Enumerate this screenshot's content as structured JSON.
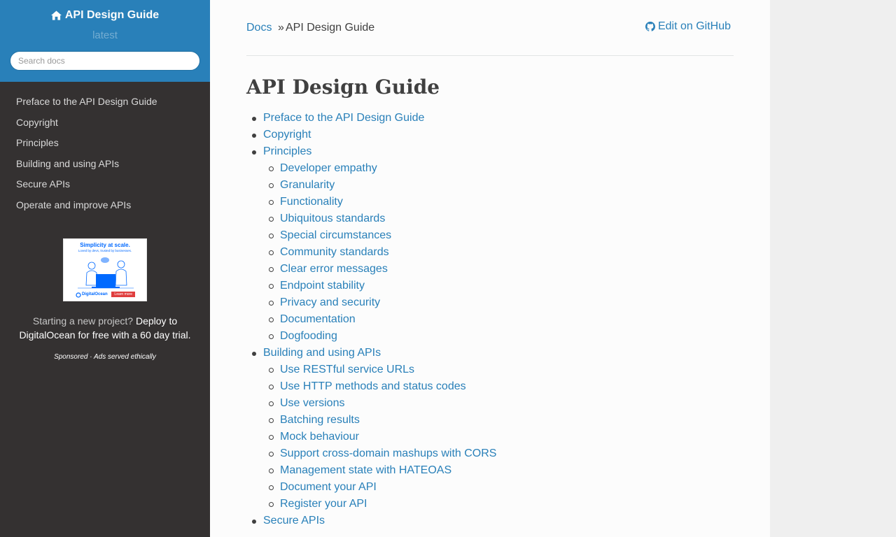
{
  "sidebar": {
    "brand": "API Design Guide",
    "version": "latest",
    "search_placeholder": "Search docs",
    "nav": [
      "Preface to the API Design Guide",
      "Copyright",
      "Principles",
      "Building and using APIs",
      "Secure APIs",
      "Operate and improve APIs"
    ],
    "ad": {
      "headline": "Simplicity at scale.",
      "subline": "Loved by devs, trusted by businesses.",
      "logo_text": "DigitalOcean",
      "cta": "Learn more",
      "text_lead": "Starting a new project?",
      "text_strong": "Deploy to DigitalOcean for free with a 60 day trial.",
      "sponsored": "Sponsored · Ads served ethically"
    }
  },
  "breadcrumbs": {
    "root": "Docs",
    "separator": "»",
    "current": "API Design Guide",
    "edit_link": "Edit on GitHub"
  },
  "page": {
    "title": "API Design Guide",
    "toc": [
      {
        "label": "Preface to the API Design Guide",
        "children": []
      },
      {
        "label": "Copyright",
        "children": []
      },
      {
        "label": "Principles",
        "children": [
          "Developer empathy",
          "Granularity",
          "Functionality",
          "Ubiquitous standards",
          "Special circumstances",
          "Community standards",
          "Clear error messages",
          "Endpoint stability",
          "Privacy and security",
          "Documentation",
          "Dogfooding"
        ]
      },
      {
        "label": "Building and using APIs",
        "children": [
          "Use RESTful service URLs",
          "Use HTTP methods and status codes",
          "Use versions",
          "Batching results",
          "Mock behaviour",
          "Support cross-domain mashups with CORS",
          "Management state with HATEOAS",
          "Document your API",
          "Register your API"
        ]
      },
      {
        "label": "Secure APIs",
        "children": []
      }
    ]
  },
  "colors": {
    "sidebar_top": "#2980b9",
    "sidebar_bg": "#343131",
    "link": "#2980b9",
    "text": "#404040",
    "content_bg": "#fcfcfc"
  }
}
